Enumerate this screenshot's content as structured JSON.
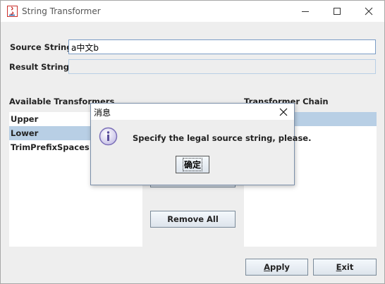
{
  "window": {
    "title": "String Transformer"
  },
  "form": {
    "source_label": "Source String",
    "source_value": "a中文b",
    "result_label": "Result String",
    "result_value": ""
  },
  "available": {
    "header": "Available Transformers",
    "items": [
      "Upper",
      "Lower",
      "TrimPrefixSpaces"
    ],
    "selected_index": 1
  },
  "chain": {
    "header": "Transformer Chain",
    "items": [
      ""
    ]
  },
  "buttons": {
    "remove_all": "Remove All",
    "apply_mnemonic": "A",
    "apply_rest": "pply",
    "exit_mnemonic": "E",
    "exit_rest": "xit"
  },
  "dialog": {
    "title": "消息",
    "message": "Specify the legal source string, please.",
    "ok_label": "确定"
  },
  "colors": {
    "selection": "#b8cfe5",
    "field_border": "#7a9cc6",
    "info_icon": "#7b6fb8"
  }
}
